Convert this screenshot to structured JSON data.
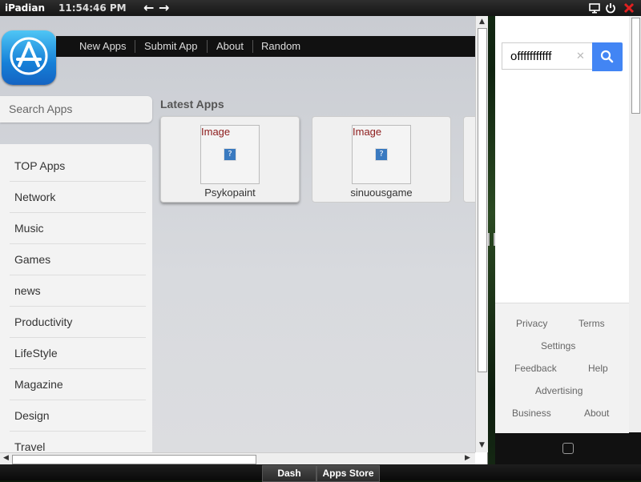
{
  "topbar": {
    "brand": "iPadian",
    "clock": "11:54:46 PM",
    "back_icon": "left-arrow",
    "forward_icon": "right-arrow",
    "system_icons": [
      "monitor-icon",
      "power-icon",
      "close-icon"
    ],
    "close_color": "#e02020"
  },
  "browser": {
    "nav": [
      "New Apps",
      "Submit App",
      "About",
      "Random"
    ],
    "search_placeholder": "Search Apps",
    "sidebar": [
      "TOP Apps",
      "Network",
      "Music",
      "Games",
      "news",
      "Productivity",
      "LifeStyle",
      "Magazine",
      "Design",
      "Travel"
    ],
    "latest_title": "Latest Apps",
    "apps": [
      {
        "alt": "Image",
        "name": "Psykopaint"
      },
      {
        "alt": "Image",
        "name": "sinuousgame"
      }
    ]
  },
  "phone": {
    "search_value": "offfffffffff",
    "footer_links": [
      "Privacy",
      "Terms",
      "Settings",
      "Feedback",
      "Help",
      "Advertising",
      "Business",
      "About"
    ],
    "accent": "#4285f4"
  },
  "taskbar": {
    "buttons": [
      "Dash",
      "Apps Store"
    ]
  }
}
